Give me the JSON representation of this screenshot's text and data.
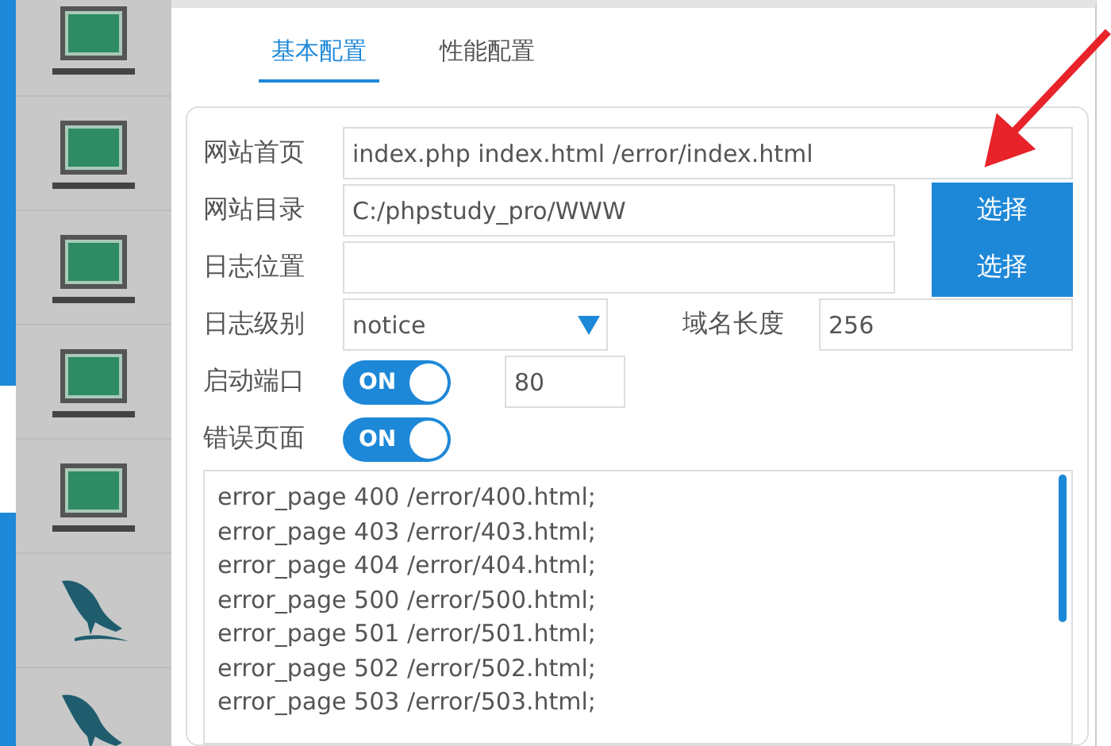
{
  "sidebar": {
    "items": [
      {
        "kind": "laptop"
      },
      {
        "kind": "laptop"
      },
      {
        "kind": "laptop"
      },
      {
        "kind": "laptop"
      },
      {
        "kind": "laptop"
      },
      {
        "kind": "dolphin"
      },
      {
        "kind": "dolphin"
      }
    ]
  },
  "tabs": [
    {
      "label": "基本配置",
      "selected": true
    },
    {
      "label": "性能配置",
      "selected": false
    }
  ],
  "form": {
    "rows": [
      {
        "kind": "text",
        "label": "网站首页",
        "value": "index.php index.html /error/index.html"
      },
      {
        "kind": "browse",
        "label": "网站目录",
        "value": "C:/phpstudy_pro/WWW",
        "button": "选择"
      },
      {
        "kind": "browse",
        "label": "日志位置",
        "value": "",
        "button": "选择"
      },
      {
        "kind": "select",
        "label": "日志级别",
        "value": "notice",
        "extra_label": "域名长度",
        "extra_value": "256"
      },
      {
        "kind": "toggle",
        "label": "启动端口",
        "on": true,
        "toggle_text": "ON",
        "extra_value": "80"
      },
      {
        "kind": "toggle",
        "label": "错误页面",
        "on": true,
        "toggle_text": "ON"
      }
    ],
    "config_lines": [
      "error_page 400 /error/400.html;",
      "error_page 403 /error/403.html;",
      "error_page 404 /error/404.html;",
      "error_page 500 /error/500.html;",
      "error_page 501 /error/501.html;",
      "error_page 502 /error/502.html;",
      "error_page 503 /error/503.html;"
    ]
  },
  "annotation_arrow": true
}
